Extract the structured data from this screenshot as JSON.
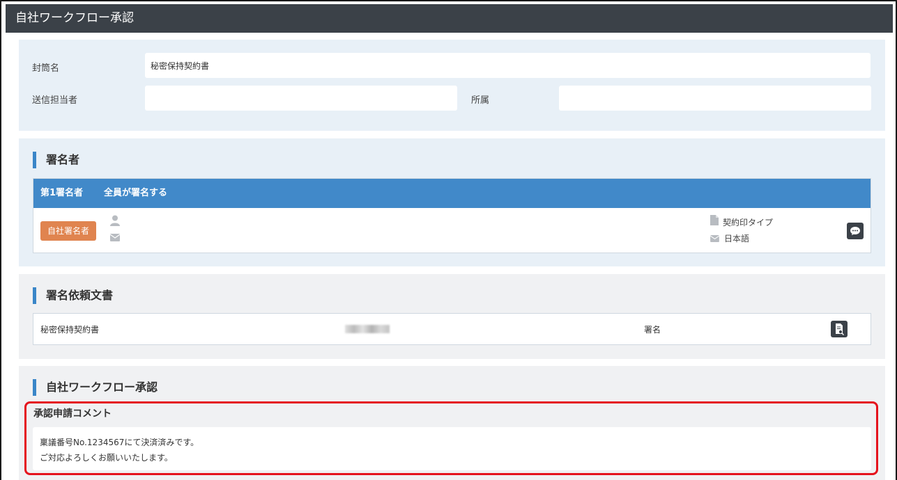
{
  "window": {
    "title": "自社ワークフロー承認"
  },
  "envelope": {
    "name_label": "封筒名",
    "name_value": "秘密保持契約書",
    "sender_label": "送信担当者",
    "sender_value": "",
    "dept_label": "所属",
    "dept_value": ""
  },
  "signers": {
    "heading": "署名者",
    "order_label": "第1署名者",
    "mode_label": "全員が署名する",
    "role_tag": "自社署名者",
    "icons": [
      "user-icon",
      "mail-icon",
      "pdf-icon",
      "chat-icon"
    ],
    "seal_type": "契約印タイプ",
    "language": "日本語"
  },
  "documents": {
    "heading": "署名依頼文書",
    "rows": [
      {
        "name": "秘密保持契約書",
        "action": "署名"
      }
    ]
  },
  "workflow": {
    "heading": "自社ワークフロー承認",
    "comment_label": "承認申請コメント",
    "comment_lines": [
      "稟議番号No.1234567にて決済済みです。",
      "ご対応よろしくお願いいたします。"
    ]
  },
  "colors": {
    "titlebar": "#3b4148",
    "accent": "#4189c9",
    "tag": "#e0844f",
    "highlight": "#e5131d"
  }
}
